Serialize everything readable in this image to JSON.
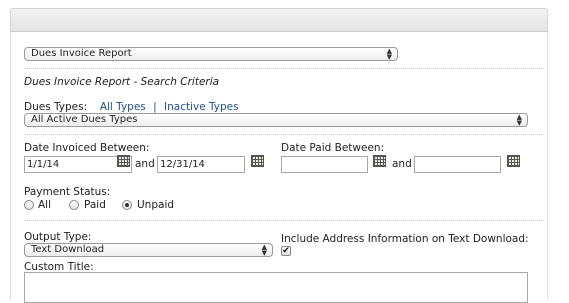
{
  "report_select": {
    "value": "Dues Invoice Report"
  },
  "section_title": "Dues Invoice Report - Search Criteria",
  "dues_types": {
    "label": "Dues Types:",
    "all_link": "All Types",
    "separator": "|",
    "inactive_link": "Inactive Types",
    "select_value": "All Active Dues Types"
  },
  "date_invoiced": {
    "label": "Date Invoiced Between:",
    "from": "1/1/14",
    "and": "and",
    "to": "12/31/14",
    "icon": "calendar-icon"
  },
  "date_paid": {
    "label": "Date Paid Between:",
    "from": "",
    "and": "and",
    "to": "",
    "icon": "calendar-icon"
  },
  "payment_status": {
    "label": "Payment Status:",
    "options": [
      "All",
      "Paid",
      "Unpaid"
    ],
    "selected": "Unpaid"
  },
  "output_type": {
    "label": "Output Type:",
    "value": "Text Download"
  },
  "include_address": {
    "label": "Include Address Information on Text Download:",
    "checked": true
  },
  "custom_title": {
    "label": "Custom Title:",
    "value": ""
  },
  "colors": {
    "link": "#23528a",
    "border": "#a8a8a8"
  }
}
